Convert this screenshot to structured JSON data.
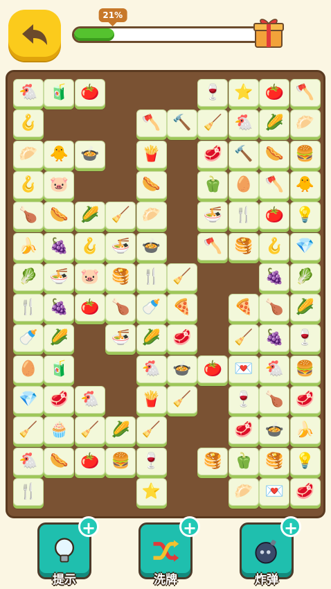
{
  "header": {
    "back_icon": "back-arrow-icon",
    "progress": {
      "label": "21%",
      "value": 0.21,
      "reward_icon": "gift-box-icon"
    }
  },
  "board": {
    "tiles": [
      {
        "r": 0,
        "c": 0,
        "icon": "🐔",
        "name": "chicken"
      },
      {
        "r": 0,
        "c": 1,
        "icon": "🧃",
        "name": "cup"
      },
      {
        "r": 0,
        "c": 2,
        "icon": "🍅",
        "name": "tomato"
      },
      {
        "r": 0,
        "c": 6,
        "icon": "🍷",
        "name": "wine"
      },
      {
        "r": 0,
        "c": 7,
        "icon": "⭐",
        "name": "star"
      },
      {
        "r": 0,
        "c": 8,
        "icon": "🍅",
        "name": "tomato"
      },
      {
        "r": 0,
        "c": 9,
        "icon": "🪓",
        "name": "axe"
      },
      {
        "r": 1,
        "c": 0,
        "icon": "🪝",
        "name": "hook"
      },
      {
        "r": 1,
        "c": 4,
        "icon": "🪓",
        "name": "axe"
      },
      {
        "r": 1,
        "c": 5,
        "icon": "🔨",
        "name": "hammer"
      },
      {
        "r": 1,
        "c": 6,
        "icon": "🧹",
        "name": "broom"
      },
      {
        "r": 1,
        "c": 7,
        "icon": "🐔",
        "name": "chicken"
      },
      {
        "r": 1,
        "c": 8,
        "icon": "🌽",
        "name": "corn"
      },
      {
        "r": 1,
        "c": 9,
        "icon": "🥟",
        "name": "dumpling"
      },
      {
        "r": 2,
        "c": 0,
        "icon": "🥟",
        "name": "dumpling"
      },
      {
        "r": 2,
        "c": 1,
        "icon": "🐥",
        "name": "chick"
      },
      {
        "r": 2,
        "c": 2,
        "icon": "🍲",
        "name": "stew"
      },
      {
        "r": 2,
        "c": 4,
        "icon": "🍟",
        "name": "fries"
      },
      {
        "r": 2,
        "c": 6,
        "icon": "🥩",
        "name": "steak"
      },
      {
        "r": 2,
        "c": 7,
        "icon": "🔨",
        "name": "hammer"
      },
      {
        "r": 2,
        "c": 8,
        "icon": "🌭",
        "name": "hotdog"
      },
      {
        "r": 2,
        "c": 9,
        "icon": "🍔",
        "name": "burger"
      },
      {
        "r": 3,
        "c": 0,
        "icon": "🪝",
        "name": "hook"
      },
      {
        "r": 3,
        "c": 1,
        "icon": "🐷",
        "name": "pig"
      },
      {
        "r": 3,
        "c": 4,
        "icon": "🌭",
        "name": "hotdog"
      },
      {
        "r": 3,
        "c": 6,
        "icon": "🫑",
        "name": "pepper"
      },
      {
        "r": 3,
        "c": 7,
        "icon": "🥚",
        "name": "egg"
      },
      {
        "r": 3,
        "c": 8,
        "icon": "🪓",
        "name": "axe"
      },
      {
        "r": 3,
        "c": 9,
        "icon": "🐥",
        "name": "chick"
      },
      {
        "r": 4,
        "c": 0,
        "icon": "🍗",
        "name": "drumstick"
      },
      {
        "r": 4,
        "c": 1,
        "icon": "🌭",
        "name": "hotdog"
      },
      {
        "r": 4,
        "c": 2,
        "icon": "🌽",
        "name": "corn"
      },
      {
        "r": 4,
        "c": 3,
        "icon": "🧹",
        "name": "shovel"
      },
      {
        "r": 4,
        "c": 4,
        "icon": "🥟",
        "name": "dumpling"
      },
      {
        "r": 4,
        "c": 6,
        "icon": "🍜",
        "name": "noodles"
      },
      {
        "r": 4,
        "c": 7,
        "icon": "🍴",
        "name": "fork"
      },
      {
        "r": 4,
        "c": 8,
        "icon": "🍅",
        "name": "tomato"
      },
      {
        "r": 4,
        "c": 9,
        "icon": "💡",
        "name": "bulb"
      },
      {
        "r": 5,
        "c": 0,
        "icon": "🍌",
        "name": "banana"
      },
      {
        "r": 5,
        "c": 1,
        "icon": "🍇",
        "name": "grapes"
      },
      {
        "r": 5,
        "c": 2,
        "icon": "🪝",
        "name": "hook"
      },
      {
        "r": 5,
        "c": 3,
        "icon": "🍜",
        "name": "noodles"
      },
      {
        "r": 5,
        "c": 4,
        "icon": "🍲",
        "name": "stew"
      },
      {
        "r": 5,
        "c": 6,
        "icon": "🪓",
        "name": "axe"
      },
      {
        "r": 5,
        "c": 7,
        "icon": "🥞",
        "name": "pancake"
      },
      {
        "r": 5,
        "c": 8,
        "icon": "🪝",
        "name": "hook"
      },
      {
        "r": 5,
        "c": 9,
        "icon": "💎",
        "name": "gem"
      },
      {
        "r": 6,
        "c": 0,
        "icon": "🥬",
        "name": "greens"
      },
      {
        "r": 6,
        "c": 1,
        "icon": "🍜",
        "name": "noodles"
      },
      {
        "r": 6,
        "c": 2,
        "icon": "🐷",
        "name": "pig"
      },
      {
        "r": 6,
        "c": 3,
        "icon": "🥞",
        "name": "pancake"
      },
      {
        "r": 6,
        "c": 4,
        "icon": "🍴",
        "name": "fork"
      },
      {
        "r": 6,
        "c": 5,
        "icon": "🧹",
        "name": "broom"
      },
      {
        "r": 6,
        "c": 8,
        "icon": "🍇",
        "name": "grapes"
      },
      {
        "r": 6,
        "c": 9,
        "icon": "🥬",
        "name": "greens"
      },
      {
        "r": 7,
        "c": 0,
        "icon": "🍴",
        "name": "fork"
      },
      {
        "r": 7,
        "c": 1,
        "icon": "🍇",
        "name": "grapes"
      },
      {
        "r": 7,
        "c": 2,
        "icon": "🍅",
        "name": "tomato"
      },
      {
        "r": 7,
        "c": 3,
        "icon": "🍗",
        "name": "drumstick"
      },
      {
        "r": 7,
        "c": 4,
        "icon": "🍼",
        "name": "bottle"
      },
      {
        "r": 7,
        "c": 5,
        "icon": "🍕",
        "name": "pizza"
      },
      {
        "r": 7,
        "c": 7,
        "icon": "🍕",
        "name": "pizza"
      },
      {
        "r": 7,
        "c": 8,
        "icon": "🍗",
        "name": "drumstick"
      },
      {
        "r": 7,
        "c": 9,
        "icon": "🌽",
        "name": "corn"
      },
      {
        "r": 8,
        "c": 0,
        "icon": "🍼",
        "name": "bottle"
      },
      {
        "r": 8,
        "c": 1,
        "icon": "🌽",
        "name": "corn"
      },
      {
        "r": 8,
        "c": 3,
        "icon": "🍜",
        "name": "noodles"
      },
      {
        "r": 8,
        "c": 4,
        "icon": "🌽",
        "name": "corn"
      },
      {
        "r": 8,
        "c": 5,
        "icon": "🥩",
        "name": "steak"
      },
      {
        "r": 8,
        "c": 7,
        "icon": "🧹",
        "name": "broom"
      },
      {
        "r": 8,
        "c": 8,
        "icon": "🍇",
        "name": "grapes"
      },
      {
        "r": 8,
        "c": 9,
        "icon": "🍷",
        "name": "wine"
      },
      {
        "r": 9,
        "c": 0,
        "icon": "🥚",
        "name": "egg"
      },
      {
        "r": 9,
        "c": 1,
        "icon": "🧃",
        "name": "cup"
      },
      {
        "r": 9,
        "c": 4,
        "icon": "🐔",
        "name": "chicken"
      },
      {
        "r": 9,
        "c": 5,
        "icon": "🍲",
        "name": "stew"
      },
      {
        "r": 9,
        "c": 6,
        "icon": "🍅",
        "name": "tomato"
      },
      {
        "r": 9,
        "c": 7,
        "icon": "💌",
        "name": "letter"
      },
      {
        "r": 9,
        "c": 8,
        "icon": "🐔",
        "name": "chicken"
      },
      {
        "r": 9,
        "c": 9,
        "icon": "🍔",
        "name": "burger"
      },
      {
        "r": 10,
        "c": 0,
        "icon": "💎",
        "name": "gem"
      },
      {
        "r": 10,
        "c": 1,
        "icon": "🥩",
        "name": "steak"
      },
      {
        "r": 10,
        "c": 2,
        "icon": "🐔",
        "name": "chicken"
      },
      {
        "r": 10,
        "c": 4,
        "icon": "🍟",
        "name": "fries"
      },
      {
        "r": 10,
        "c": 5,
        "icon": "🧹",
        "name": "broom"
      },
      {
        "r": 10,
        "c": 7,
        "icon": "🍷",
        "name": "wine"
      },
      {
        "r": 10,
        "c": 8,
        "icon": "🍗",
        "name": "drumstick"
      },
      {
        "r": 10,
        "c": 9,
        "icon": "🥩",
        "name": "steak"
      },
      {
        "r": 11,
        "c": 0,
        "icon": "🧹",
        "name": "shovel"
      },
      {
        "r": 11,
        "c": 1,
        "icon": "🧁",
        "name": "cupcake"
      },
      {
        "r": 11,
        "c": 2,
        "icon": "🧹",
        "name": "shovel"
      },
      {
        "r": 11,
        "c": 3,
        "icon": "🌽",
        "name": "corn"
      },
      {
        "r": 11,
        "c": 4,
        "icon": "🧹",
        "name": "shovel"
      },
      {
        "r": 11,
        "c": 7,
        "icon": "🥩",
        "name": "steak"
      },
      {
        "r": 11,
        "c": 8,
        "icon": "🍲",
        "name": "stew"
      },
      {
        "r": 11,
        "c": 9,
        "icon": "🍌",
        "name": "banana"
      },
      {
        "r": 12,
        "c": 0,
        "icon": "🐔",
        "name": "chicken"
      },
      {
        "r": 12,
        "c": 1,
        "icon": "🌭",
        "name": "hotdog"
      },
      {
        "r": 12,
        "c": 2,
        "icon": "🍅",
        "name": "tomato"
      },
      {
        "r": 12,
        "c": 3,
        "icon": "🍔",
        "name": "burger"
      },
      {
        "r": 12,
        "c": 4,
        "icon": "🍷",
        "name": "wine"
      },
      {
        "r": 12,
        "c": 6,
        "icon": "🥞",
        "name": "pancake"
      },
      {
        "r": 12,
        "c": 7,
        "icon": "🫑",
        "name": "pepper"
      },
      {
        "r": 12,
        "c": 8,
        "icon": "🥞",
        "name": "pancake"
      },
      {
        "r": 12,
        "c": 9,
        "icon": "💡",
        "name": "bulb"
      },
      {
        "r": 13,
        "c": 0,
        "icon": "🍴",
        "name": "fork"
      },
      {
        "r": 13,
        "c": 4,
        "icon": "⭐",
        "name": "star"
      },
      {
        "r": 13,
        "c": 7,
        "icon": "🥟",
        "name": "dumpling"
      },
      {
        "r": 13,
        "c": 8,
        "icon": "💌",
        "name": "letter"
      },
      {
        "r": 13,
        "c": 9,
        "icon": "🥩",
        "name": "steak"
      }
    ]
  },
  "tools": [
    {
      "key": "hint",
      "label": "提示",
      "icon": "lightbulb-icon"
    },
    {
      "key": "shuffle",
      "label": "洗牌",
      "icon": "shuffle-icon"
    },
    {
      "key": "bomb",
      "label": "炸弹",
      "icon": "bomb-icon"
    }
  ],
  "colors": {
    "background": "#fbf6e3",
    "board": "#7a5233",
    "tile": "#f3f8da",
    "tile_edge": "#9ec75a",
    "tool_button": "#1fbfae",
    "back_button": "#fbcb1c",
    "progress_fill": "#55c22f"
  }
}
